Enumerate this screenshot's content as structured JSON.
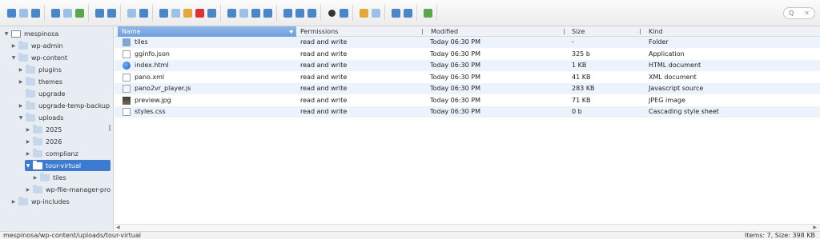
{
  "toolbar": {
    "groups": [
      [
        "back-icon",
        "forward-icon",
        "up-icon"
      ],
      [
        "reload-icon",
        "new-folder-icon",
        "save-icon"
      ],
      [
        "open-icon",
        "archive-icon"
      ],
      [
        "undo-icon",
        "redo-icon"
      ],
      [
        "copy-icon",
        "cut-icon",
        "paste-icon",
        "delete-icon",
        "rename-icon"
      ],
      [
        "duplicate-icon",
        "edit-icon",
        "select-icon",
        "resize-icon"
      ],
      [
        "view-icons-icon",
        "view-grid-icon",
        "view-list-icon"
      ],
      [
        "preview-icon",
        "info-icon"
      ],
      [
        "extract-icon",
        "compress-icon"
      ],
      [
        "sort-icon",
        "help-icon"
      ],
      [
        "fullscreen-icon"
      ]
    ],
    "search_placeholder": "Q"
  },
  "tree": [
    {
      "label": "mespinosa",
      "indent": 0,
      "expanded": true,
      "root": true,
      "selected": false
    },
    {
      "label": "wp-admin",
      "indent": 1,
      "expanded": false,
      "root": false,
      "selected": false
    },
    {
      "label": "wp-content",
      "indent": 1,
      "expanded": true,
      "root": false,
      "selected": false
    },
    {
      "label": "plugins",
      "indent": 2,
      "expanded": false,
      "root": false,
      "selected": false
    },
    {
      "label": "themes",
      "indent": 2,
      "expanded": false,
      "root": false,
      "selected": false
    },
    {
      "label": "upgrade",
      "indent": 2,
      "expanded": null,
      "root": false,
      "selected": false
    },
    {
      "label": "upgrade-temp-backup",
      "indent": 2,
      "expanded": false,
      "root": false,
      "selected": false
    },
    {
      "label": "uploads",
      "indent": 2,
      "expanded": true,
      "root": false,
      "selected": false
    },
    {
      "label": "2025",
      "indent": 3,
      "expanded": false,
      "root": false,
      "selected": false
    },
    {
      "label": "2026",
      "indent": 3,
      "expanded": false,
      "root": false,
      "selected": false
    },
    {
      "label": "complianz",
      "indent": 3,
      "expanded": false,
      "root": false,
      "selected": false
    },
    {
      "label": "tour-virtual",
      "indent": 3,
      "expanded": true,
      "root": false,
      "selected": true
    },
    {
      "label": "tiles",
      "indent": 4,
      "expanded": false,
      "root": false,
      "selected": false
    },
    {
      "label": "wp-file-manager-pro",
      "indent": 3,
      "expanded": false,
      "root": false,
      "selected": false
    },
    {
      "label": "wp-includes",
      "indent": 1,
      "expanded": false,
      "root": false,
      "selected": false
    }
  ],
  "columns": {
    "name": "Name",
    "permissions": "Permissions",
    "modified": "Modified",
    "size": "Size",
    "kind": "Kind"
  },
  "files": [
    {
      "name": "tiles",
      "permissions": "read and write",
      "modified": "Today 06:30 PM",
      "size": "-",
      "kind": "Folder",
      "icon": "folder"
    },
    {
      "name": "gginfo.json",
      "permissions": "read and write",
      "modified": "Today 06:30 PM",
      "size": "325 b",
      "kind": "Application",
      "icon": "json"
    },
    {
      "name": "index.html",
      "permissions": "read and write",
      "modified": "Today 06:30 PM",
      "size": "1 KB",
      "kind": "HTML document",
      "icon": "html"
    },
    {
      "name": "pano.xml",
      "permissions": "read and write",
      "modified": "Today 06:30 PM",
      "size": "41 KB",
      "kind": "XML document",
      "icon": "xml"
    },
    {
      "name": "pano2vr_player.js",
      "permissions": "read and write",
      "modified": "Today 06:30 PM",
      "size": "283 KB",
      "kind": "Javascript source",
      "icon": "js"
    },
    {
      "name": "preview.jpg",
      "permissions": "read and write",
      "modified": "Today 06:30 PM",
      "size": "71 KB",
      "kind": "JPEG image",
      "icon": "jpg"
    },
    {
      "name": "styles.css",
      "permissions": "read and write",
      "modified": "Today 06:30 PM",
      "size": "0 b",
      "kind": "Cascading style sheet",
      "icon": "css"
    }
  ],
  "status": {
    "path": "mespinosa/wp-content/uploads/tour-virtual",
    "info": "Items: 7, Size: 398 KB"
  }
}
